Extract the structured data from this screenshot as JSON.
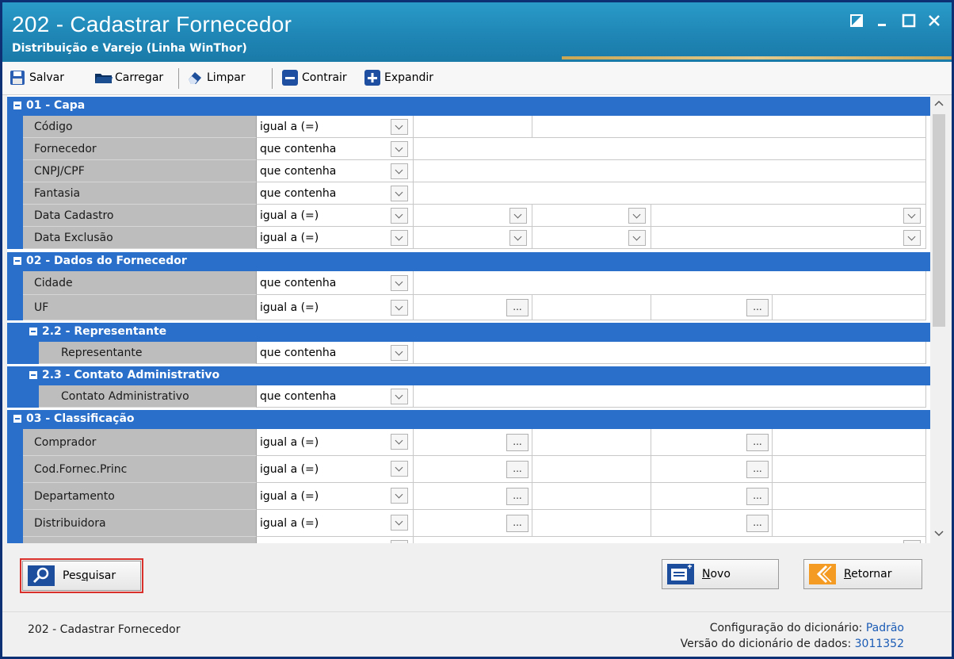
{
  "window": {
    "title": "202 - Cadastrar  Fornecedor",
    "subtitle": "Distribuição e Varejo (Linha WinThor)"
  },
  "toolbar": {
    "salvar": "Salvar",
    "carregar": "Carregar",
    "limpar": "Limpar",
    "contrair": "Contrair",
    "expandir": "Expandir"
  },
  "sections": {
    "capa": "01 - Capa",
    "dados_fornecedor": "02 - Dados do Fornecedor",
    "representante": "2.2 - Representante",
    "contato": "2.3 - Contato Administrativo",
    "classificacao": "03 - Classificação"
  },
  "fields": {
    "codigo": {
      "label": "Código",
      "op": "igual a (=)"
    },
    "fornecedor": {
      "label": "Fornecedor",
      "op": "que contenha"
    },
    "cnpj": {
      "label": "CNPJ/CPF",
      "op": "que contenha"
    },
    "fantasia": {
      "label": "Fantasia",
      "op": "que contenha"
    },
    "data_cadastro": {
      "label": "Data Cadastro",
      "op": "igual a (=)"
    },
    "data_exclusao": {
      "label": "Data Exclusão",
      "op": "igual a (=)"
    },
    "cidade": {
      "label": "Cidade",
      "op": "que contenha"
    },
    "uf": {
      "label": "UF",
      "op": "igual a (=)"
    },
    "representante": {
      "label": "Representante",
      "op": "que contenha"
    },
    "contato": {
      "label": "Contato Administrativo",
      "op": "que contenha"
    },
    "comprador": {
      "label": "Comprador",
      "op": "igual a (=)"
    },
    "cod_fornec": {
      "label": "Cod.Fornec.Princ",
      "op": "igual a (=)"
    },
    "departamento": {
      "label": "Departamento",
      "op": "igual a (=)"
    },
    "distribuidora": {
      "label": "Distribuidora",
      "op": "igual a (=)"
    }
  },
  "dots_label": "...",
  "buttons": {
    "pesquisar_pre": "Pes",
    "pesquisar_u": "q",
    "pesquisar_post": "uisar",
    "novo_u": "N",
    "novo_post": "ovo",
    "retornar_u": "R",
    "retornar_post": "etornar"
  },
  "status": {
    "screen": "202 - Cadastrar  Fornecedor",
    "config_label": "Configuração do dicionário:",
    "config_value": "Padrão",
    "version_label": "Versão do dicionário de dados:",
    "version_value": "3011352"
  },
  "colors": {
    "section_bg": "#2a6fc9",
    "title_bg": "#1f86b5",
    "label_bg": "#bdbdbd"
  }
}
